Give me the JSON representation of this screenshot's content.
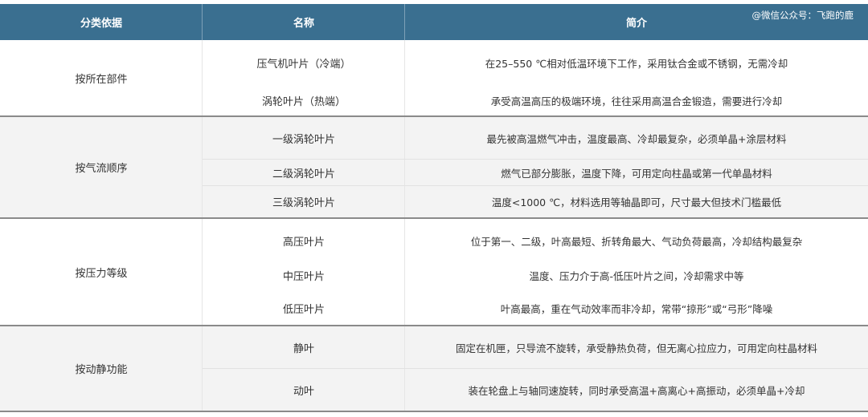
{
  "header": {
    "col_category": "分类依据",
    "col_name": "名称",
    "col_desc": "简介",
    "watermark": "@微信公众号：飞跑的鹿"
  },
  "groups": [
    {
      "category": "按所在部件",
      "rows": [
        {
          "name": "压气机叶片（冷端）",
          "desc": "在25–550 ℃相对低温环境下工作，采用钛合金或不锈钢，无需冷却"
        },
        {
          "name": "涡轮叶片（热端）",
          "desc": "承受高温高压的极端环境，往往采用高温合金锻造，需要进行冷却"
        }
      ]
    },
    {
      "category": "按气流顺序",
      "rows": [
        {
          "name": "一级涡轮叶片",
          "desc": "最先被高温燃气冲击，温度最高、冷却最复杂，必须单晶+涂层材料"
        },
        {
          "name": "二级涡轮叶片",
          "desc": "燃气已部分膨胀，温度下降，可用定向柱晶或第一代单晶材料"
        },
        {
          "name": "三级涡轮叶片",
          "desc": "温度<1000 ℃，材料选用等轴晶即可，尺寸最大但技术门槛最低"
        }
      ]
    },
    {
      "category": "按压力等级",
      "rows": [
        {
          "name": "高压叶片",
          "desc": "位于第一、二级，叶高最短、折转角最大、气动负荷最高，冷却结构最复杂"
        },
        {
          "name": "中压叶片",
          "desc": "温度、压力介于高-低压叶片之间，冷却需求中等"
        },
        {
          "name": "低压叶片",
          "desc": "叶高最高，重在气动效率而非冷却，常带“掠形”或“弓形”降噪"
        }
      ]
    },
    {
      "category": "按动静功能",
      "rows": [
        {
          "name": "静叶",
          "desc": "固定在机匣，只导流不旋转，承受静热负荷，但无离心拉应力，可用定向柱晶材料"
        },
        {
          "name": "动叶",
          "desc": "装在轮盘上与轴同速旋转，同时承受高温+高离心+高振动，必须单晶+冷却"
        }
      ]
    }
  ]
}
